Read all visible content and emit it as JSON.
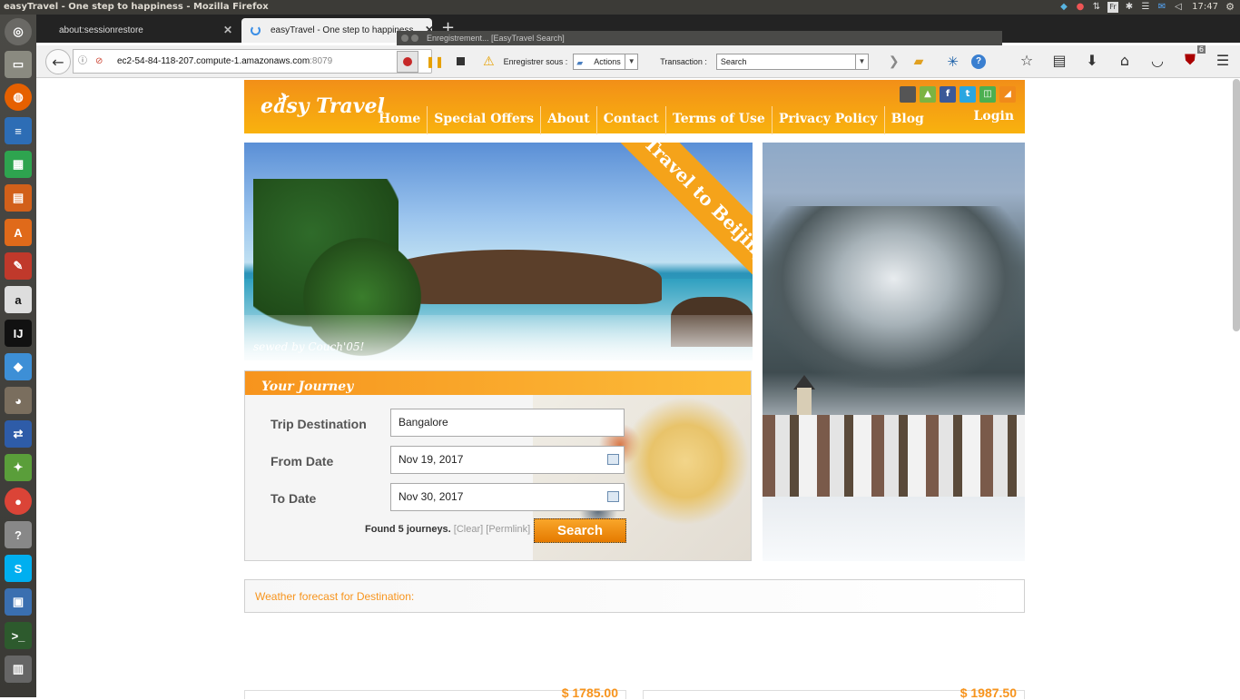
{
  "system": {
    "window_title": "easyTravel - One step to happiness - Mozilla Firefox",
    "clock": "17:47"
  },
  "browser": {
    "tabs": [
      {
        "title": "about:sessionrestore"
      },
      {
        "title": "easyTravel - One step to happiness"
      }
    ],
    "url_host": "ec2-54-84-118-207.compute-1.amazonaws.com",
    "url_port": ":8079",
    "recorder_banner": "Enregistrement... [EasyTravel  Search]",
    "recorder": {
      "save_as_label": "Enregistrer sous :",
      "actions_value": "Actions",
      "transaction_label": "Transaction :",
      "transaction_value": "Search"
    },
    "badge_count": "6"
  },
  "site": {
    "logo": "easy Travel",
    "nav": [
      "Home",
      "Special Offers",
      "About",
      "Contact",
      "Terms of Use",
      "Privacy Policy",
      "Blog"
    ],
    "login": "Login",
    "hero_ribbon": "Travel to Beijing",
    "hero_credit": "sewed by Couch'05!",
    "journey": {
      "title": "Your Journey",
      "destination_label": "Trip Destination",
      "destination_value": "Bangalore",
      "from_label": "From Date",
      "from_value": "Nov 19, 2017",
      "to_label": "To Date",
      "to_value": "Nov 30, 2017",
      "found_text": "Found 5 journeys.",
      "clear_link": "[Clear]",
      "permalink": "[Permlink]",
      "search_button": "Search"
    },
    "weather_label": "Weather forecast for Destination:",
    "card_prices": [
      "$ 1785.00",
      "$ 1987.50"
    ]
  },
  "colors": {
    "brand_orange": "#f7941d",
    "launcher_bg": "#3c3b37"
  }
}
